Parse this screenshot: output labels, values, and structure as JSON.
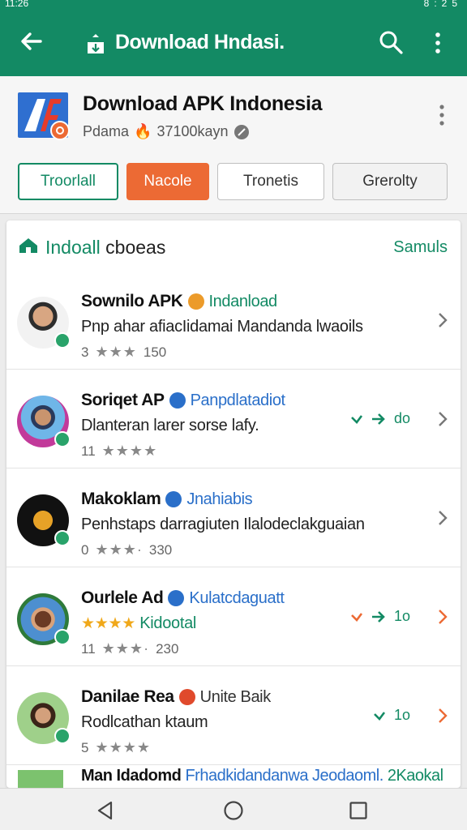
{
  "status_bar": {
    "left_text": "11:26",
    "right_text": "8:25"
  },
  "app_bar": {
    "title": "Download Hndasi.",
    "background": "#138a64"
  },
  "header": {
    "app_title": "Download APK Indonesia",
    "meta_label": "Pdama",
    "meta_tag": "🔥",
    "meta_count": "37100kayn"
  },
  "chips": [
    {
      "label": "Troorlall"
    },
    {
      "label": "Nacole"
    },
    {
      "label": "Tronetis"
    },
    {
      "label": "Grerolty"
    }
  ],
  "list": {
    "title_colored": "Indoall",
    "title_rest": "cboeas",
    "link": "Samuls",
    "rows": [
      {
        "name": "Sownilo APK",
        "sub": "Indanload",
        "desc": "Pnp ahar afiacIidamai Mandanda lwaoils",
        "rating": "3",
        "count": "150",
        "action": ""
      },
      {
        "name": "Soriqet AP",
        "sub": "Panpdlatadiot",
        "desc": "Dlanteran larer sorse lafy.",
        "rating": "11",
        "count": "",
        "action": "do"
      },
      {
        "name": "Makoklam",
        "sub": "Jnahiabis",
        "desc": "Penhstaps darragiuten Ilalodeclakguaian",
        "rating": "0",
        "count": "330",
        "action": ""
      },
      {
        "name": "Ourlele Ad",
        "sub": "Kulatcdaguatt",
        "desc": "Kidootal",
        "rating": "11",
        "count": "230",
        "action": "1o"
      },
      {
        "name": "Danilae Rea",
        "sub": "Unite Baik",
        "desc": "Rodlcathan ktaum",
        "rating": "5",
        "count": "",
        "action": "1o"
      }
    ],
    "bottom_text_bold": "Man Idadomd",
    "bottom_text_blue": "Frhadkidandanwa Jeodaoml.",
    "bottom_text_green": "2Kaokal"
  },
  "colors": {
    "accent": "#138a64",
    "orange": "#ec6a34",
    "blue": "#2a6fc9",
    "star": "#f0a81a"
  }
}
